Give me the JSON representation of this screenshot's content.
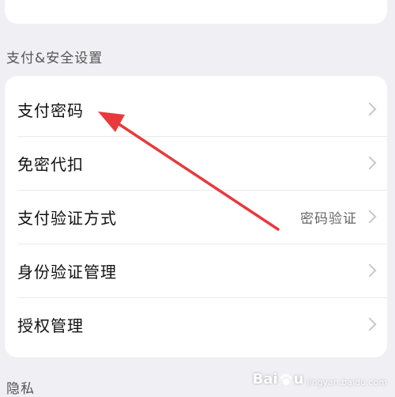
{
  "sections": {
    "pay_security_title": "支付&安全设置",
    "privacy_title": "隐私"
  },
  "settings": {
    "items": [
      {
        "label": "支付密码",
        "value": ""
      },
      {
        "label": "免密代扣",
        "value": ""
      },
      {
        "label": "支付验证方式",
        "value": "密码验证"
      },
      {
        "label": "身份验证管理",
        "value": ""
      },
      {
        "label": "授权管理",
        "value": ""
      }
    ]
  },
  "annotation": {
    "arrow_color": "#e8393c"
  },
  "watermark": {
    "brand_left": "Bai",
    "brand_right": "u",
    "sub": "jingyan.baidu.com"
  },
  "colors": {
    "background": "#efeff4",
    "card": "#ffffff",
    "chevron": "#c7c7cc"
  }
}
